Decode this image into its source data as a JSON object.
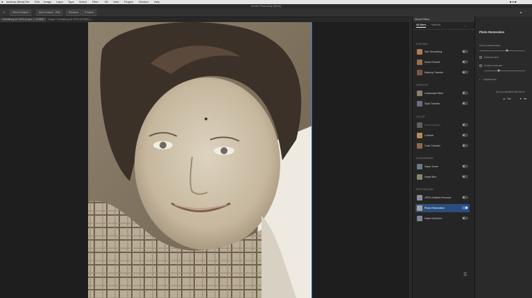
{
  "menubar": {
    "apple": "",
    "items": [
      "otoshop (Beta)",
      "File",
      "Edit",
      "Image",
      "Layer",
      "Type",
      "Select",
      "Filter",
      "3D",
      "View",
      "Plugins",
      "Window",
      "Help"
    ]
  },
  "titlebar": {
    "title": "Adobe Photoshop (Beta)"
  },
  "optionsbar": {
    "home_icon": "home-icon",
    "btn1": "Select Subject",
    "btn2": "Auto Enhance",
    "btn3": "Edit",
    "btn4": "Enhance",
    "btn5": "Preview"
  },
  "doc_tabs": [
    {
      "label": "Gestaltung @ 100% (Layer 1, RGB/8) *"
    },
    {
      "label": "Image / Gestaltung @ 100% (RGB/8) ×"
    }
  ],
  "neural_filters": {
    "header": "Neural Filters",
    "subtabs": [
      "All filters",
      "Wait list"
    ],
    "sections": [
      {
        "title": "PORTRAIT",
        "items": [
          {
            "label": "Skin Smoothing",
            "on": false,
            "color": "#b07a5a"
          },
          {
            "label": "Smart Portrait",
            "on": false,
            "color": "#9a6d4e"
          },
          {
            "label": "Makeup Transfer",
            "on": false,
            "color": "#7d5643"
          }
        ]
      },
      {
        "title": "CREATIVE",
        "items": [
          {
            "label": "Landscape Mixer",
            "on": false,
            "color": "#8a7f6a"
          },
          {
            "label": "Style Transfer",
            "on": false,
            "color": "#6f6a7e"
          }
        ]
      },
      {
        "title": "COLOR",
        "items": [
          {
            "label": "Harmonization",
            "on": false,
            "color": "#5f5f5f",
            "dim": true
          },
          {
            "label": "Colorize",
            "on": false,
            "color": "#b38b5c"
          },
          {
            "label": "Color Transfer",
            "on": false,
            "color": "#8a6a4c"
          }
        ]
      },
      {
        "title": "ENVIRONMENT",
        "items": [
          {
            "label": "Super Zoom",
            "on": false,
            "color": "#6b7a86"
          },
          {
            "label": "Depth Blur",
            "on": false,
            "color": "#7d8a6c"
          }
        ]
      },
      {
        "title": "RESTORATION",
        "items": [
          {
            "label": "JPEG Artifacts Removal",
            "on": false,
            "color": "#8a8f9a"
          },
          {
            "label": "Photo Restoration",
            "on": true,
            "color": "#a8a39a",
            "selected": true
          },
          {
            "label": "Noise reduction",
            "on": false,
            "color": "#7a8694"
          }
        ]
      }
    ]
  },
  "detail": {
    "title": "Photo Restoration",
    "photo_enhancement": "Photo enhancement",
    "enhance_face": "Enhance face",
    "scratch_reduction": "Scratch reduction",
    "adjustments": "Adjustments",
    "question": "Are you satisfied with the re",
    "yes": "Yes",
    "no": "No",
    "slider1": 0.6,
    "slider2": 0.35
  }
}
